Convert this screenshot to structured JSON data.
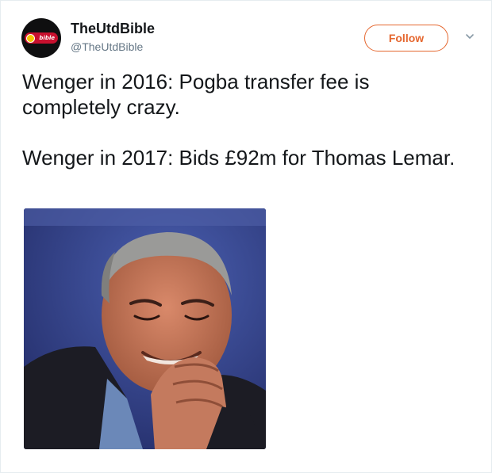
{
  "account": {
    "display_name": "TheUtdBible",
    "handle": "@TheUtdBible",
    "avatar_badge_text": "bible"
  },
  "actions": {
    "follow_label": "Follow",
    "more_icon": "chevron-down-icon"
  },
  "tweet": {
    "paragraphs": [
      "Wenger in 2016: Pogba transfer fee is completely crazy.",
      "Wenger in 2017: Bids £92m for Thomas Lemar."
    ]
  },
  "colors": {
    "follow_accent": "#e5672f",
    "text": "#14171a",
    "secondary_text": "#657786",
    "avatar_badge": "#c8102e"
  }
}
